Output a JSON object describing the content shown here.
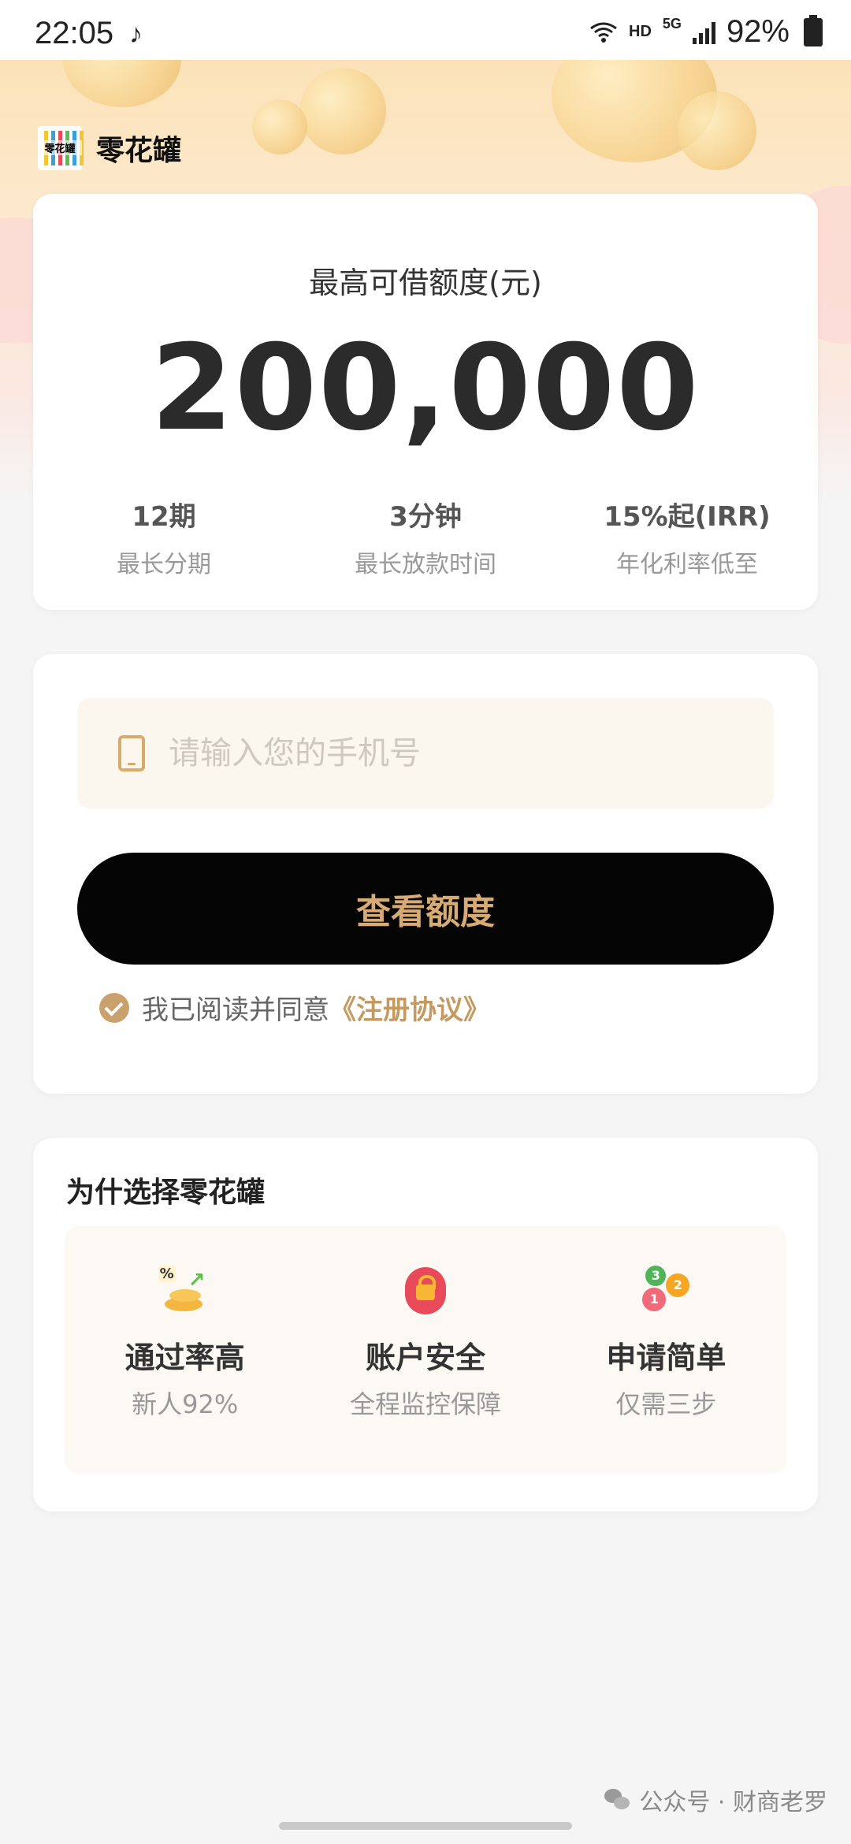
{
  "status_bar": {
    "time": "22:05",
    "hd": "HD",
    "network": "5G",
    "battery": "92%"
  },
  "brand": {
    "logo_text": "零花罐",
    "name": "零花罐"
  },
  "credit": {
    "label": "最高可借额度(元)",
    "amount": "200,000",
    "stats": [
      {
        "value": "12期",
        "desc": "最长分期"
      },
      {
        "value": "3分钟",
        "desc": "最长放款时间"
      },
      {
        "value": "15%起(IRR)",
        "desc": "年化利率低至"
      }
    ]
  },
  "form": {
    "phone_placeholder": "请输入您的手机号",
    "phone_value": "",
    "cta_label": "查看额度",
    "agree_text": "我已阅读并同意",
    "agree_link": "《注册协议》",
    "agree_checked": true
  },
  "why": {
    "title": "为什选择零花罐",
    "features": [
      {
        "title": "通过率高",
        "subtitle": "新人92%",
        "icon": "growth-coins-icon"
      },
      {
        "title": "账户安全",
        "subtitle": "全程监控保障",
        "icon": "shield-lock-icon"
      },
      {
        "title": "申请简单",
        "subtitle": "仅需三步",
        "icon": "numbered-steps-icon"
      }
    ],
    "step_numbers": [
      "3",
      "2",
      "1"
    ],
    "percent_symbol": "%"
  },
  "watermark": "公众号 · 财商老罗",
  "colors": {
    "accent_gold": "#d9ab74",
    "cta_bg": "#050505",
    "link_gold": "#c49a62"
  }
}
